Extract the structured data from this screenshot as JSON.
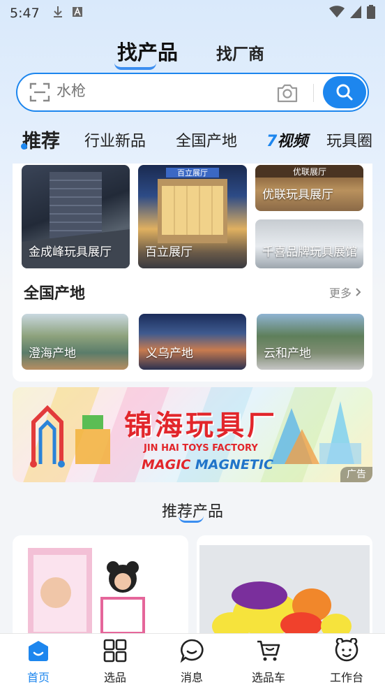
{
  "status_bar": {
    "time": "5:47",
    "icons": [
      "download-icon",
      "a-icon",
      "wifi-icon",
      "signal-icon",
      "battery-icon"
    ]
  },
  "top_tabs": {
    "active": "找产品",
    "secondary": "找厂商"
  },
  "search": {
    "placeholder": "水枪"
  },
  "categories": [
    "推荐",
    "行业新品",
    "全国产地",
    "视频",
    "玩具圈"
  ],
  "showrooms": [
    {
      "label": "金成峰玩具展厅"
    },
    {
      "label": "百立展厅"
    },
    {
      "label": "优联玩具展厅"
    },
    {
      "label": "千喜品牌玩具展馆"
    }
  ],
  "origins_section": {
    "title": "全国产地",
    "more": "更多"
  },
  "origins": [
    {
      "label": "澄海产地"
    },
    {
      "label": "义乌产地"
    },
    {
      "label": "云和产地"
    }
  ],
  "banner": {
    "title": "锦海玩具厂",
    "subtitle": "JIN HAI TOYS FACTORY",
    "tagline_a": "MAGIC ",
    "tagline_b": "MAGNETIC",
    "ad_label": "广告"
  },
  "recommend": {
    "title": "推荐产品"
  },
  "bottom_nav": [
    {
      "label": "首页",
      "icon": "home-icon",
      "active": true
    },
    {
      "label": "选品",
      "icon": "grid-icon",
      "active": false
    },
    {
      "label": "消息",
      "icon": "chat-icon",
      "active": false
    },
    {
      "label": "选品车",
      "icon": "cart-icon",
      "active": false
    },
    {
      "label": "工作台",
      "icon": "workbench-icon",
      "active": false
    }
  ],
  "colors": {
    "accent": "#1d86ee",
    "banner_red": "#e2262b"
  }
}
